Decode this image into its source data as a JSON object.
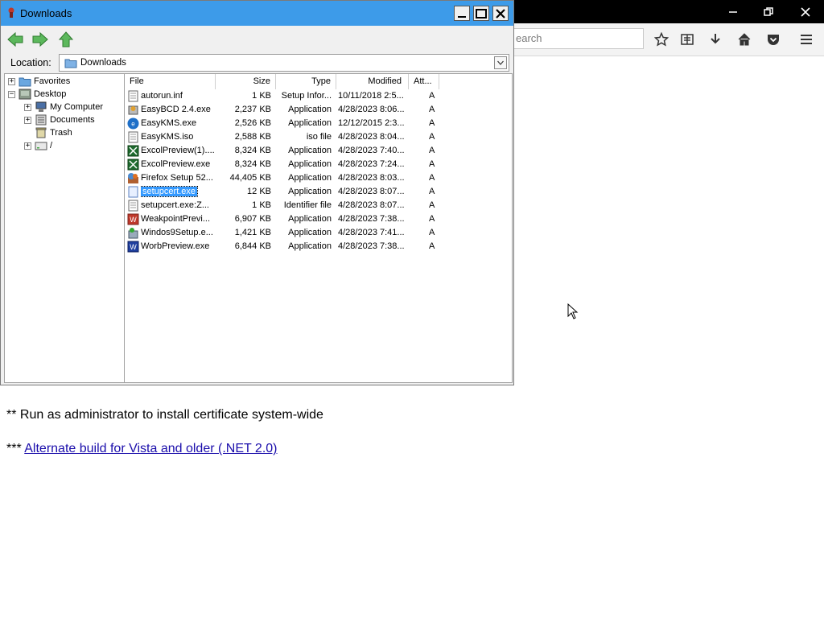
{
  "browser": {
    "search_placeholder": "earch",
    "page_lines": {
      "line1_prefix": "** Run as administrator to install certificate system-wide",
      "line2_prefix": "***",
      "line2_link": "Alternate build for Vista and older (.NET 2.0)"
    }
  },
  "window": {
    "title": "Downloads",
    "location_label": "Location:",
    "location_value": "Downloads"
  },
  "tree": {
    "items": [
      {
        "label": "Favorites"
      },
      {
        "label": "Desktop"
      },
      {
        "label": "My Computer"
      },
      {
        "label": "Documents"
      },
      {
        "label": "Trash"
      },
      {
        "label": "/"
      }
    ]
  },
  "columns": {
    "file": "File",
    "size": "Size",
    "type": "Type",
    "modified": "Modified",
    "attributes": "Att..."
  },
  "files": [
    {
      "name": "autorun.inf",
      "size": "1 KB",
      "type": "Setup Infor...",
      "modified": "10/11/2018 2:5...",
      "att": "A",
      "icon": "text-file-icon"
    },
    {
      "name": "EasyBCD 2.4.exe",
      "size": "2,237 KB",
      "type": "Application",
      "modified": "4/28/2023 8:06...",
      "att": "A",
      "icon": "installer-icon"
    },
    {
      "name": "EasyKMS.exe",
      "size": "2,526 KB",
      "type": "Application",
      "modified": "12/12/2015 2:3...",
      "att": "A",
      "icon": "kms-app-icon"
    },
    {
      "name": "EasyKMS.iso",
      "size": "2,588 KB",
      "type": "iso file",
      "modified": "4/28/2023 8:04...",
      "att": "A",
      "icon": "text-file-icon"
    },
    {
      "name": "ExcolPreview(1)....",
      "size": "8,324 KB",
      "type": "Application",
      "modified": "4/28/2023 7:40...",
      "att": "A",
      "icon": "spreadsheet-app-icon"
    },
    {
      "name": "ExcolPreview.exe",
      "size": "8,324 KB",
      "type": "Application",
      "modified": "4/28/2023 7:24...",
      "att": "A",
      "icon": "spreadsheet-app-icon"
    },
    {
      "name": "Firefox Setup 52...",
      "size": "44,405 KB",
      "type": "Application",
      "modified": "4/28/2023 8:03...",
      "att": "A",
      "icon": "firefox-setup-icon"
    },
    {
      "name": "setupcert.exe",
      "size": "12 KB",
      "type": "Application",
      "modified": "4/28/2023 8:07...",
      "att": "A",
      "icon": "application-icon",
      "selected": true
    },
    {
      "name": "setupcert.exe:Z...",
      "size": "1 KB",
      "type": "Identifier file",
      "modified": "4/28/2023 8:07...",
      "att": "A",
      "icon": "text-file-icon"
    },
    {
      "name": "WeakpointPrevi...",
      "size": "6,907 KB",
      "type": "Application",
      "modified": "4/28/2023 7:38...",
      "att": "A",
      "icon": "presentation-app-icon"
    },
    {
      "name": "Windos9Setup.e...",
      "size": "1,421 KB",
      "type": "Application",
      "modified": "4/28/2023 7:41...",
      "att": "A",
      "icon": "setup-icon"
    },
    {
      "name": "WorbPreview.exe",
      "size": "6,844 KB",
      "type": "Application",
      "modified": "4/28/2023 7:38...",
      "att": "A",
      "icon": "word-app-icon"
    }
  ],
  "colors": {
    "titlebar": "#3d9be9",
    "selection": "#3399ff",
    "link": "#1a0dab"
  }
}
